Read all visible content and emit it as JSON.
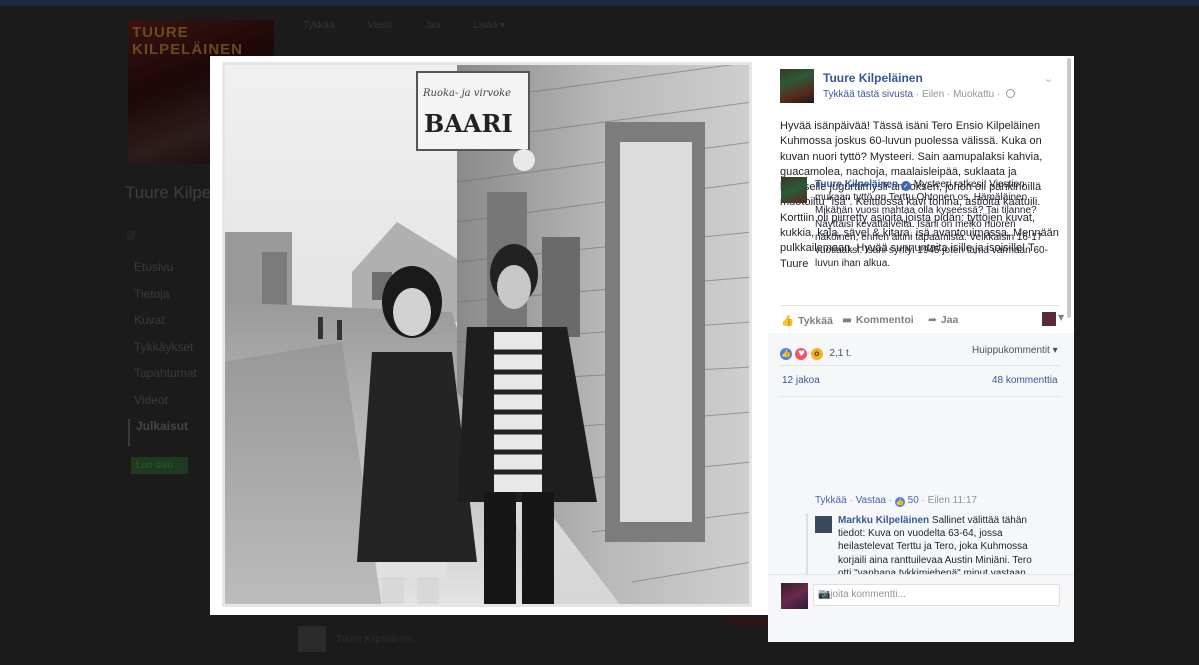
{
  "background": {
    "page_name": "Tuure Kilpeläinen",
    "cover_text": "TUURE KILPELÄINEN",
    "actions": [
      "Tykkää",
      "Viesti",
      "Jaa",
      "Lisää ▾"
    ],
    "nav": [
      "Etusivu",
      "Tietoja",
      "Kuvat",
      "Tykkäykset",
      "Tapahtumat",
      "Videot",
      "Julkaisut"
    ],
    "green_button": "Luo sivu",
    "bottom_author": "Tuure Kilpeläinen"
  },
  "post": {
    "page_name": "Tuure Kilpeläinen",
    "like_page": "Tykkää tästä sivusta",
    "time": "Eilen",
    "edited": "Muokattu",
    "text": "Hyvää isänpäivää! Tässä isäni Tero Ensio Kilpeläinen Kuhmossa joskus 60-luvun puolessa välissä. Kuka on kuvan nuori tyttö? Mysteeri. Sain aamupalaksi kahvia, guacamolea, nachoja, maalaisleipää, suklaata ja lautaselle jugurttimysli-annoksen, johon oli pähkinöillä muotoiltu \"isä\". Keittiössä kävi tohina, astioita kaatuili. Korttiin oli piirretty asioita joista pidän: tyttöjen kuvat, kukkia, kala, sävel & kitara, isä avantouimassa. Mennään pulkkailemaan. Hyvää sunnuntaita isille ja isoisille! T. Tuure",
    "actions": {
      "like": "Tykkää",
      "comment": "Kommentoi",
      "share": "Jaa"
    },
    "reaction_count": "2,1 t.",
    "top_comments": "Huippukommentit ▾",
    "shares": "12 jakoa",
    "comments": "48 kommenttia"
  },
  "comments": [
    {
      "author": "Tuure Kilpeläinen",
      "text": "Mysteeri ratkesi! Viestien mukaan tyttö on Terttu Ohtonen os. Hämäläinen. Mikähän vuosi mahtaa olla kyseessä? Tai tilanne? Näyttäisi kevättalvelta. Isäni on melko nuoren näköinen, ennen äitini tapaamista. Veikkaisin 16-17 vuotiaaksi. Isäni syntyi 1945 joten tämä varmaan 60-luvun ihan alkua.",
      "like": "Tykkää",
      "reply": "Vastaa",
      "likes": "50",
      "time": "Eilen 11:17"
    },
    {
      "author": "Markku Kilpeläinen",
      "text": "Sallinet välittää tähän tiedot: Kuva on vuodelta 63-64, jossa heilastelevat Terttu ja Tero, joka Kuhmossa korjaili aina ranttuilevaa Austin Miniäni. Tero otti \"vanhana tykkimiehenä\" minut vastaan"
    }
  ],
  "write_comment_placeholder": "Kirjoita kommentti...",
  "photo": {
    "sign_top": "Ruoka- ja virvoke",
    "sign_main": "BAARI"
  }
}
